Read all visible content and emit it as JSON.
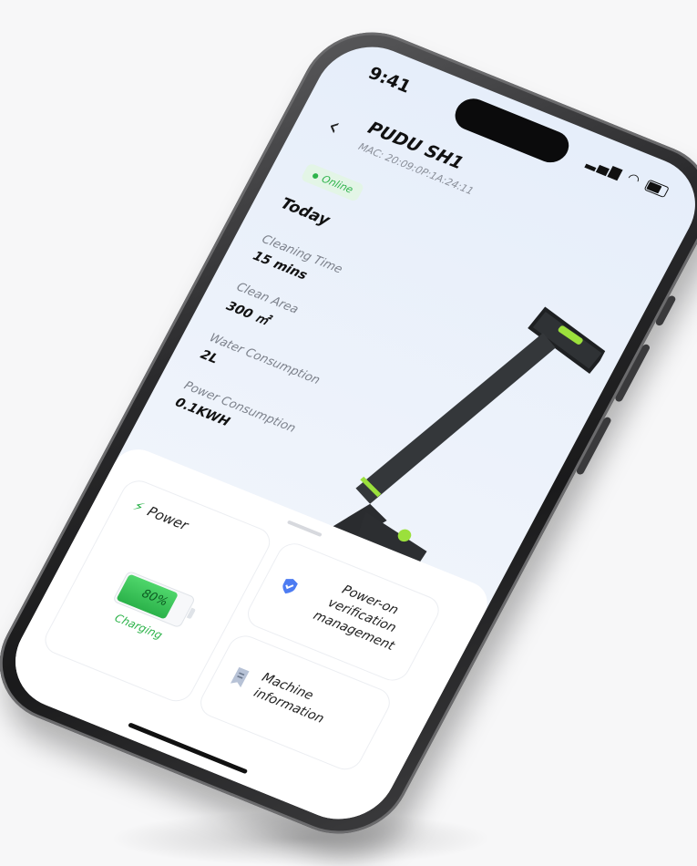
{
  "status_bar": {
    "time": "9:41",
    "signal_icon": "signal-icon",
    "wifi_icon": "wifi-icon",
    "battery_icon": "battery-icon"
  },
  "header": {
    "title": "PUDU SH1",
    "mac": "MAC: 20:09:0P:1A:24:11",
    "back_icon": "chevron-left-icon"
  },
  "status": {
    "label": "Online",
    "color": "#2db34a"
  },
  "today": {
    "title": "Today",
    "stats": [
      {
        "label": "Cleaning Time",
        "value": "15 mins"
      },
      {
        "label": "Clean Area",
        "value": "300 ㎡"
      },
      {
        "label": "Water Consumption",
        "value": "2L"
      },
      {
        "label": "Power Consumption",
        "value": "0.1KWH"
      }
    ]
  },
  "panel": {
    "power": {
      "title": "Power",
      "level_percent": 80,
      "level_text": "80%",
      "status": "Charging",
      "icon": "lightning-bolt-icon"
    },
    "verification": {
      "label": "Power-on verification management",
      "icon": "shield-check-icon"
    },
    "machine": {
      "label": "Machine information",
      "icon": "document-icon"
    }
  },
  "colors": {
    "accent": "#2db34a",
    "screen_bg": "#e6eefa",
    "device_body": "#3a3d40",
    "device_highlight": "#9be03c"
  }
}
